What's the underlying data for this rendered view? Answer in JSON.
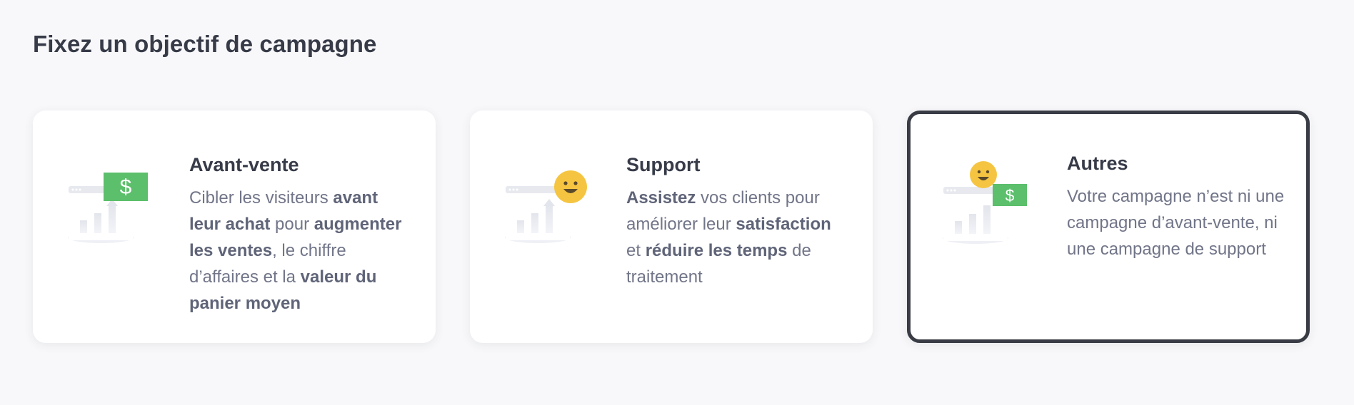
{
  "page": {
    "heading": "Fixez un objectif de campagne"
  },
  "cards": [
    {
      "title": "Avant-vente",
      "selected": false,
      "icon": "presale-chart-dollar-icon",
      "description": [
        {
          "text": "Cibler les visiteurs ",
          "bold": false
        },
        {
          "text": "avant leur achat",
          "bold": true
        },
        {
          "text": " pour ",
          "bold": false
        },
        {
          "text": "augmenter les ventes",
          "bold": true
        },
        {
          "text": ", le chiffre d’affaires et la ",
          "bold": false
        },
        {
          "text": "valeur du panier moyen",
          "bold": true
        }
      ]
    },
    {
      "title": "Support",
      "selected": false,
      "icon": "support-chart-smiley-icon",
      "description": [
        {
          "text": "Assistez",
          "bold": true
        },
        {
          "text": " vos clients pour améliorer leur ",
          "bold": false
        },
        {
          "text": "satisfaction",
          "bold": true
        },
        {
          "text": " et ",
          "bold": false
        },
        {
          "text": "réduire les temps",
          "bold": true
        },
        {
          "text": " de traitement",
          "bold": false
        }
      ]
    },
    {
      "title": "Autres",
      "selected": true,
      "icon": "other-chart-smiley-dollar-icon",
      "description": [
        {
          "text": "Votre campagne n’est ni une campagne d’avant-vente, ni une campagne de support",
          "bold": false
        }
      ]
    }
  ],
  "colors": {
    "heading_text": "#373b48",
    "body_text": "#717588",
    "bold_text": "#5f6478",
    "selected_border": "#393c44",
    "dollar_green": "#5bbf6b",
    "smiley_yellow": "#f5c542",
    "page_background": "#f8f8fa",
    "card_background": "#ffffff"
  },
  "glyphs": {
    "dollar": "$"
  }
}
